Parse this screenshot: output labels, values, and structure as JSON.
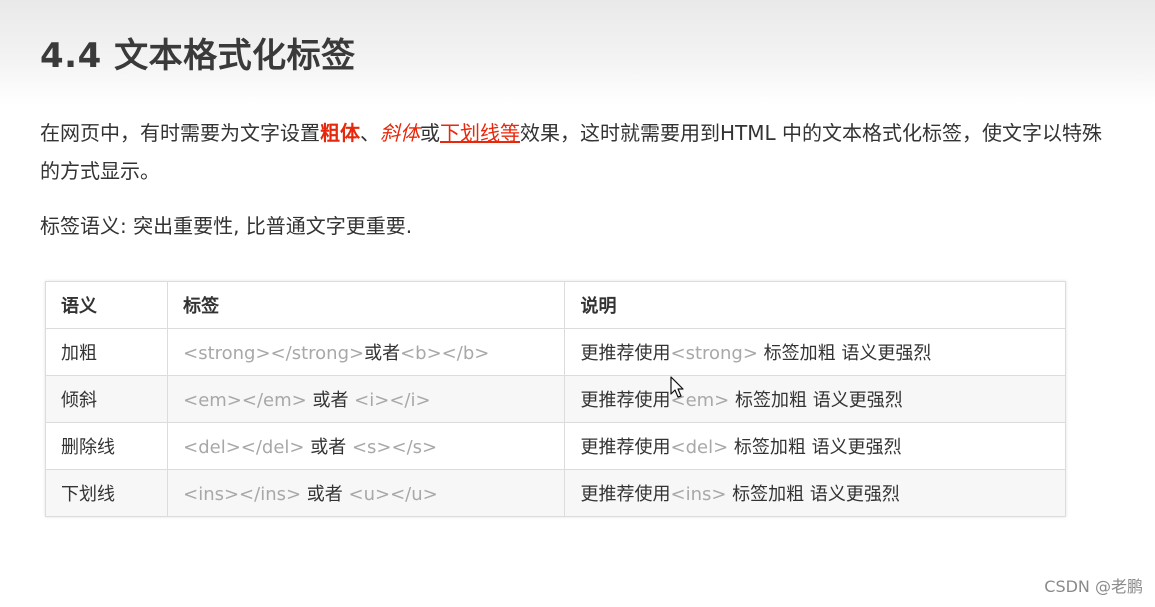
{
  "slide": {
    "title": "4.4 文本格式化标签",
    "intro": {
      "part1": "在网页中，有时需要为文字设置",
      "bold_word": "粗体",
      "sep1": "、",
      "italic_word": "斜体",
      "sep2": "或",
      "underline_word": "下划线等",
      "part2": "效果，这时就需要用到HTML 中的文本格式化标签，使文字以特殊的方式显示。"
    },
    "semantic_note": "标签语义: 突出重要性, 比普通文字更重要."
  },
  "table": {
    "headers": [
      "语义",
      "标签",
      "说明"
    ],
    "rows": [
      {
        "semantic": "加粗",
        "tag_code1": "<strong></strong>",
        "tag_sep": "或者",
        "tag_code2": "<b></b>",
        "desc_prefix": "更推荐使用",
        "desc_code": "<strong>",
        "desc_suffix": " 标签加粗 语义更强烈"
      },
      {
        "semantic": "倾斜",
        "tag_code1": "<em></em>",
        "tag_sep": " 或者 ",
        "tag_code2": "<i></i>",
        "desc_prefix": "更推荐使用",
        "desc_code": "<em>",
        "desc_suffix": " 标签加粗 语义更强烈"
      },
      {
        "semantic": "删除线",
        "tag_code1": "<del></del>",
        "tag_sep": " 或者 ",
        "tag_code2": "<s></s>",
        "desc_prefix": "更推荐使用",
        "desc_code": "<del>",
        "desc_suffix": " 标签加粗 语义更强烈"
      },
      {
        "semantic": "下划线",
        "tag_code1": "<ins></ins>",
        "tag_sep": " 或者 ",
        "tag_code2": "<u></u>",
        "desc_prefix": "更推荐使用",
        "desc_code": "<ins>",
        "desc_suffix": " 标签加粗 语义更强烈"
      }
    ]
  },
  "watermark": "CSDN @老鹏",
  "colors": {
    "accent_red": "#e8280c",
    "code_gray": "#a8a8a8",
    "text": "#333333"
  },
  "icons": {
    "cursor": "mouse-pointer-icon"
  }
}
